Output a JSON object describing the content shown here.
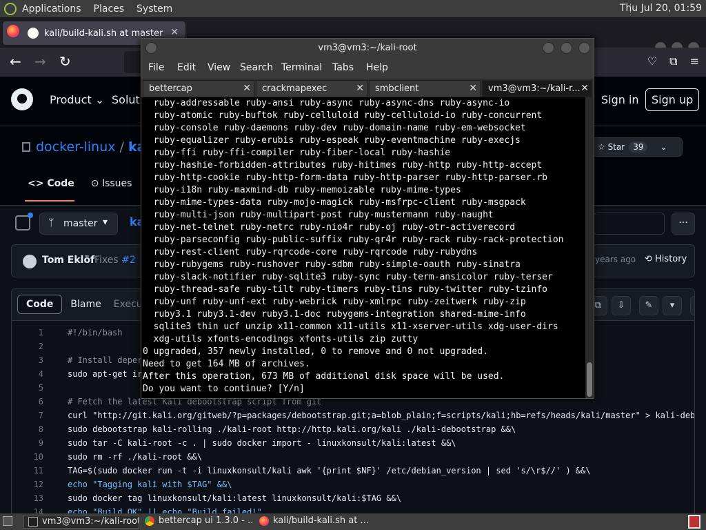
{
  "system_panel": {
    "menus": [
      "Applications",
      "Places",
      "System"
    ],
    "clock": "Thu Jul 20, 01:59"
  },
  "browser": {
    "tab_title": "kali/build-kali.sh at master",
    "tab_close": "✕",
    "new_tab": "+"
  },
  "github": {
    "nav": [
      "Product",
      "Soluti"
    ],
    "sign_in": "Sign in",
    "sign_up": "Sign up",
    "repo_owner": "docker-linux",
    "repo_sep": "/",
    "repo_name": "kali",
    "star_label": "Star",
    "star_count": "39",
    "tabs": [
      "Code",
      "Issues"
    ],
    "branch": "master",
    "breadcrumb": "ka",
    "more": "···",
    "commit": {
      "author": "Tom Eklöf",
      "message": "Fixes",
      "issue": "#2",
      "age": "years ago",
      "history": "History"
    },
    "code_tabs": {
      "code": "Code",
      "blame": "Blame",
      "exec": "Execu"
    },
    "code_lines": [
      {
        "n": "1",
        "t": "#!/bin/bash"
      },
      {
        "n": "2",
        "t": ""
      },
      {
        "n": "3",
        "t": "# Install deper"
      },
      {
        "n": "4",
        "t": "sudo apt-get ir"
      },
      {
        "n": "5",
        "t": ""
      },
      {
        "n": "6",
        "t": "# Fetch the latest Kali debootstrap script from git"
      },
      {
        "n": "7",
        "t": "curl \"http://git.kali.org/gitweb/?p=packages/debootstrap.git;a=blob_plain;f=scripts/kali;hb=refs/heads/kali/master\" > kali-debo"
      },
      {
        "n": "8",
        "t": "sudo debootstrap kali-rolling ./kali-root http://http.kali.org/kali ./kali-debootstrap &&\\"
      },
      {
        "n": "9",
        "t": "sudo tar -C kali-root -c . | sudo docker import - linuxkonsult/kali:latest &&\\"
      },
      {
        "n": "10",
        "t": "sudo rm -rf ./kali-root &&\\"
      },
      {
        "n": "11",
        "t": "TAG=$(sudo docker run -t -i linuxkonsult/kali awk '{print $NF}' /etc/debian_version | sed 's/\\r$//' ) &&\\"
      },
      {
        "n": "12",
        "t": "echo \"Tagging kali with $TAG\" &&\\"
      },
      {
        "n": "13",
        "t": "sudo docker tag linuxkonsult/kali:latest linuxkonsult/kali:$TAG &&\\"
      },
      {
        "n": "14",
        "t": "echo \"Build OK\" || echo \"Build failed!\""
      }
    ]
  },
  "terminal": {
    "title": "vm3@vm3:~/kali-root",
    "menu": [
      "File",
      "Edit",
      "View",
      "Search",
      "Terminal",
      "Tabs",
      "Help"
    ],
    "tabs": [
      "bettercap",
      "crackmapexec",
      "smbclient",
      "vm3@vm3:~/kali-r..."
    ],
    "tab_close": "✕",
    "lines": [
      "  ruby-addressable ruby-ansi ruby-async ruby-async-dns ruby-async-io",
      "  ruby-atomic ruby-buftok ruby-celluloid ruby-celluloid-io ruby-concurrent",
      "  ruby-console ruby-daemons ruby-dev ruby-domain-name ruby-em-websocket",
      "  ruby-equalizer ruby-erubis ruby-espeak ruby-eventmachine ruby-execjs",
      "  ruby-ffi ruby-ffi-compiler ruby-fiber-local ruby-hashie",
      "  ruby-hashie-forbidden-attributes ruby-hitimes ruby-http ruby-http-accept",
      "  ruby-http-cookie ruby-http-form-data ruby-http-parser ruby-http-parser.rb",
      "  ruby-i18n ruby-maxmind-db ruby-memoizable ruby-mime-types",
      "  ruby-mime-types-data ruby-mojo-magick ruby-msfrpc-client ruby-msgpack",
      "  ruby-multi-json ruby-multipart-post ruby-mustermann ruby-naught",
      "  ruby-net-telnet ruby-netrc ruby-nio4r ruby-oj ruby-otr-activerecord",
      "  ruby-parseconfig ruby-public-suffix ruby-qr4r ruby-rack ruby-rack-protection",
      "  ruby-rest-client ruby-rqrcode-core ruby-rqrcode ruby-rubydns",
      "  ruby-rubygems ruby-rushover ruby-sdbm ruby-simple-oauth ruby-sinatra",
      "  ruby-slack-notifier ruby-sqlite3 ruby-sync ruby-term-ansicolor ruby-terser",
      "  ruby-thread-safe ruby-tilt ruby-timers ruby-tins ruby-twitter ruby-tzinfo",
      "  ruby-unf ruby-unf-ext ruby-webrick ruby-xmlrpc ruby-zeitwerk ruby-zip",
      "  ruby3.1 ruby3.1-dev ruby3.1-doc rubygems-integration shared-mime-info",
      "  sqlite3 thin ucf unzip x11-common x11-utils x11-xserver-utils xdg-user-dirs",
      "  xdg-utils xfonts-encodings xfonts-utils zip zutty",
      "0 upgraded, 357 newly installed, 0 to remove and 0 not upgraded.",
      "Need to get 164 MB of archives.",
      "After this operation, 673 MB of additional disk space will be used.",
      "Do you want to continue? [Y/n]"
    ]
  },
  "taskbar": {
    "tasks": [
      "vm3@vm3:~/kali-root",
      "bettercap ui 1.3.0 - ...",
      "kali/build-kali.sh at ..."
    ]
  }
}
